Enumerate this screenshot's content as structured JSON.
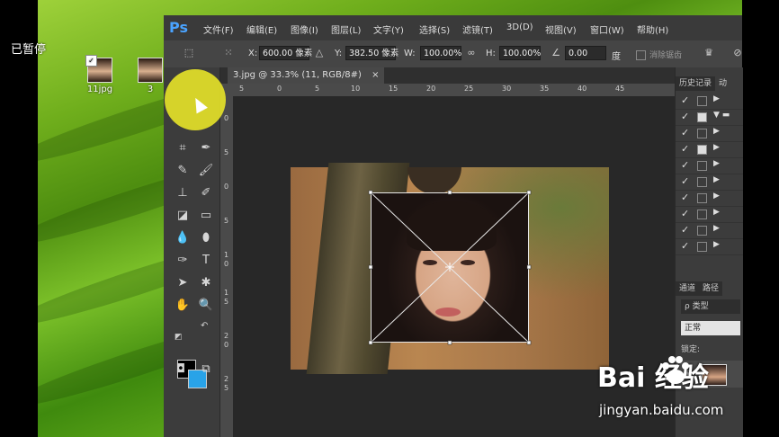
{
  "overlay": {
    "paused_label": "已暂停"
  },
  "desktop_icons": [
    {
      "label": "11jpg"
    },
    {
      "label": "3"
    }
  ],
  "photoshop": {
    "logo": "Ps",
    "menus": [
      "文件(F)",
      "编辑(E)",
      "图像(I)",
      "图层(L)",
      "文字(Y)",
      "选择(S)",
      "滤镜(T)",
      "3D(D)",
      "视图(V)",
      "窗口(W)",
      "帮助(H)"
    ],
    "options": {
      "x_label": "X:",
      "x_value": "600.00 像素",
      "y_label": "Y:",
      "y_value": "382.50 像素",
      "w_label": "W:",
      "w_value": "100.00%",
      "h_label": "H:",
      "h_value": "100.00%",
      "angle_value": "0.00",
      "degree_unit": "度",
      "antialias_label": "消除锯齿"
    },
    "document": {
      "tab_title": "3.jpg @ 33.3% (11, RGB/8#)",
      "tab_close": "×",
      "ruler_h": [
        "5",
        "0",
        "5",
        "10",
        "15",
        "20",
        "25",
        "30",
        "35",
        "40",
        "45"
      ],
      "ruler_v": [
        "0",
        "5",
        "0",
        "5",
        "1",
        "0",
        "1",
        "5",
        "2",
        "0",
        "2",
        "5"
      ]
    },
    "right_panel": {
      "history_tab": "历史记录",
      "actions_tab": "动",
      "channels_tab": "通道",
      "paths_tab": "路径",
      "layer_filter": "ρ 类型",
      "blend_mode": "正常",
      "lock_label": "锁定:"
    }
  },
  "watermark": {
    "brand": "Bai  经验",
    "url": "jingyan.baidu.com"
  },
  "colors": {
    "foreground": "#000000",
    "background": "#29a3e8",
    "highlight": "#ece828",
    "ps_blue": "#4aa3ff"
  }
}
